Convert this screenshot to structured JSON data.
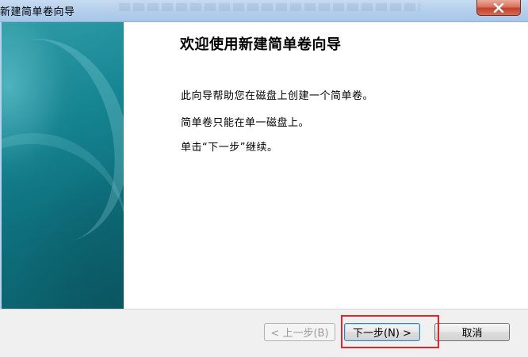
{
  "window": {
    "title": "新建简单卷向导",
    "close_symbol": "✕"
  },
  "content": {
    "heading": "欢迎使用新建简单卷向导",
    "paragraphs": [
      "此向导帮助您在磁盘上创建一个简单卷。",
      "简单卷只能在单一磁盘上。",
      "单击“下一步”继续。"
    ]
  },
  "buttons": {
    "back": "< 上一步(B)",
    "next": "下一步(N) >",
    "cancel": "取消"
  },
  "colors": {
    "panel_teal": "#168592",
    "highlight": "#e3242b",
    "close_red": "#c4412a"
  }
}
